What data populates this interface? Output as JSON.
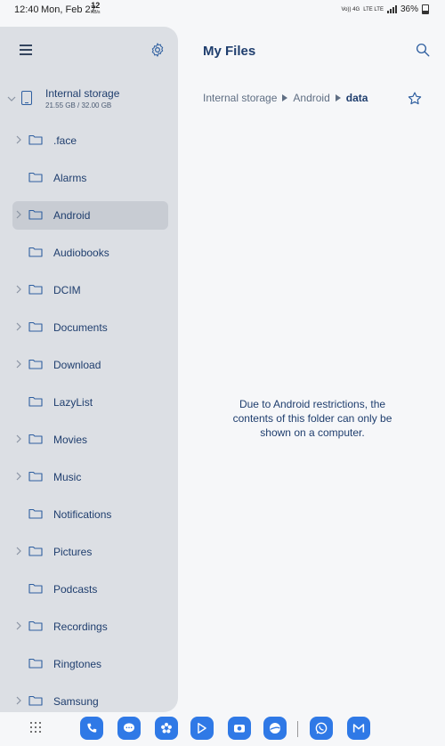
{
  "status_bar": {
    "time": "12:40",
    "date": "Mon, Feb 27",
    "network_speed_value": "12",
    "network_speed_unit": "KB/s",
    "volte": "Vo)) 4G",
    "lte": "LTE LTE",
    "battery": "36%"
  },
  "sidebar": {
    "storage": {
      "name": "Internal storage",
      "size": "21.55 GB / 32.00 GB"
    },
    "folders": [
      {
        "label": ".face",
        "expandable": true,
        "selected": false
      },
      {
        "label": "Alarms",
        "expandable": false,
        "selected": false
      },
      {
        "label": "Android",
        "expandable": true,
        "selected": true
      },
      {
        "label": "Audiobooks",
        "expandable": false,
        "selected": false
      },
      {
        "label": "DCIM",
        "expandable": true,
        "selected": false
      },
      {
        "label": "Documents",
        "expandable": true,
        "selected": false
      },
      {
        "label": "Download",
        "expandable": true,
        "selected": false
      },
      {
        "label": "LazyList",
        "expandable": false,
        "selected": false
      },
      {
        "label": "Movies",
        "expandable": true,
        "selected": false
      },
      {
        "label": "Music",
        "expandable": true,
        "selected": false
      },
      {
        "label": "Notifications",
        "expandable": false,
        "selected": false
      },
      {
        "label": "Pictures",
        "expandable": true,
        "selected": false
      },
      {
        "label": "Podcasts",
        "expandable": false,
        "selected": false
      },
      {
        "label": "Recordings",
        "expandable": true,
        "selected": false
      },
      {
        "label": "Ringtones",
        "expandable": false,
        "selected": false
      },
      {
        "label": "Samsung",
        "expandable": true,
        "selected": false
      }
    ]
  },
  "main": {
    "title": "My Files",
    "breadcrumb": [
      "Internal storage",
      "Android",
      "data"
    ],
    "message": "Due to Android restrictions, the contents of this folder can only be shown on a computer."
  },
  "dock": {
    "apps": [
      "phone-icon",
      "messages-icon",
      "gallery-flower-icon",
      "play-store-icon",
      "camera-icon",
      "browser-icon",
      "whatsapp-icon",
      "gmail-icon"
    ]
  },
  "colors": {
    "accent": "#2f79e6",
    "text_primary": "#1f3e6e",
    "sidebar_bg": "#dcdfe4",
    "selected_bg": "#c8ccd3",
    "page_bg": "#f6f7f9"
  }
}
